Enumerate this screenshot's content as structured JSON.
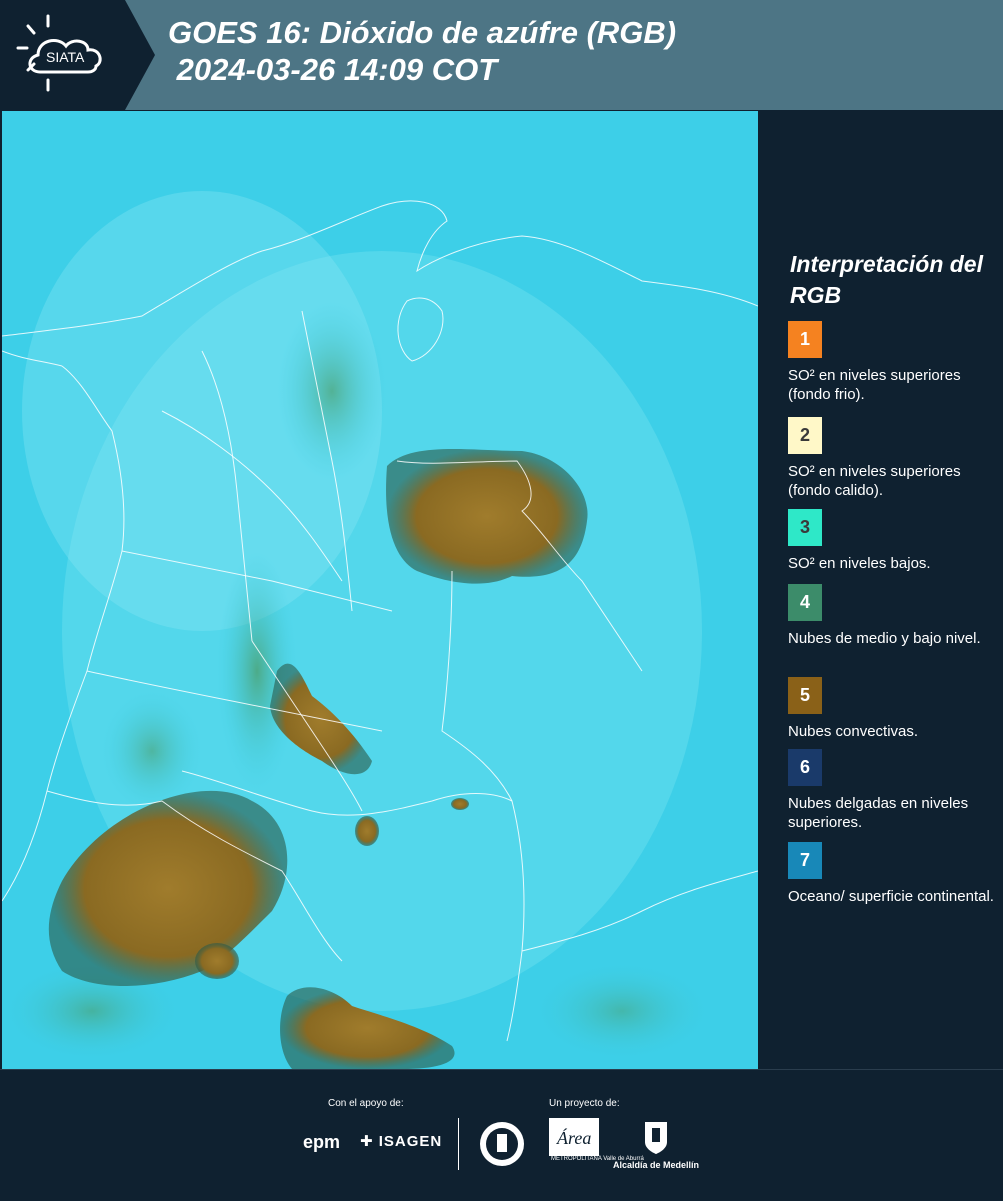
{
  "header": {
    "logo_text": "SIATA",
    "title": "GOES 16: Dióxido de azúfre (RGB)\n 2024-03-26 14:09 COT"
  },
  "legend": {
    "title": "Interpretación del RGB",
    "items": [
      {
        "number": "1",
        "color": "#f58220",
        "number_color": "#ffffff",
        "label": "SO² en niveles superiores (fondo frio)."
      },
      {
        "number": "2",
        "color": "#fff8c8",
        "number_color": "#3a3a3a",
        "label": "SO² en niveles superiores (fondo calido)."
      },
      {
        "number": "3",
        "color": "#2ee8c8",
        "number_color": "#3a3a3a",
        "label": "SO² en niveles bajos."
      },
      {
        "number": "4",
        "color": "#3c8c6a",
        "number_color": "#ffffff",
        "label": "Nubes de medio y bajo nivel."
      },
      {
        "number": "5",
        "color": "#8a6118",
        "number_color": "#ffffff",
        "label": "Nubes convectivas."
      },
      {
        "number": "6",
        "color": "#1a3a6a",
        "number_color": "#ffffff",
        "label": "Nubes delgadas en niveles superiores."
      },
      {
        "number": "7",
        "color": "#1888b8",
        "number_color": "#ffffff",
        "label": "Oceano/ superficie continental."
      }
    ]
  },
  "footer": {
    "support_label": "Con el apoyo de:",
    "project_label": "Un proyecto de:",
    "sponsor_epm": "epm",
    "sponsor_isagen": "ISAGEN",
    "area_label": "Área",
    "area_sub": "METROPOLITANA Valle de Aburrá",
    "alcaldia_label": "Alcaldía de Medellín"
  },
  "colors": {
    "header_bg": "#4d7585",
    "logo_bg": "#0f2130",
    "background": "#0f2130",
    "map_surface": "#3dcfe8",
    "convective_cloud": "#9a7a2a",
    "border_line": "#ffffff"
  }
}
